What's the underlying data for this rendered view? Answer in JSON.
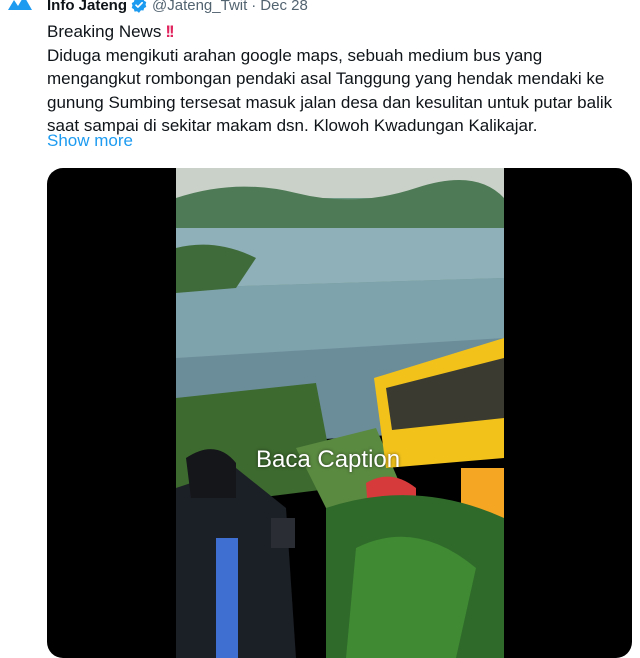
{
  "tweet": {
    "author_name": "Info Jateng",
    "handle": "@Jateng_Twit",
    "separator": "·",
    "date": "Dec 28",
    "headline": "Breaking News",
    "headline_emoji": "!!",
    "body": "Diduga mengikuti arahan google maps, sebuah medium bus yang mengangkut rombongan pendaki asal Tanggung yang hendak mendaki ke gunung Sumbing tersesat masuk jalan desa dan kesulitan untuk putar balik saat sampai di sekitar makam dsn. Klowoh Kwadungan Kalikajar.",
    "show_more": "Show more"
  },
  "video": {
    "overlay_caption": "Baca Caption"
  },
  "colors": {
    "link": "#1d9bf0",
    "verified_badge": "#1d9bf0",
    "secondary_text": "#536471",
    "bus_yellow": "#f2c21b",
    "media_background": "#000000"
  }
}
